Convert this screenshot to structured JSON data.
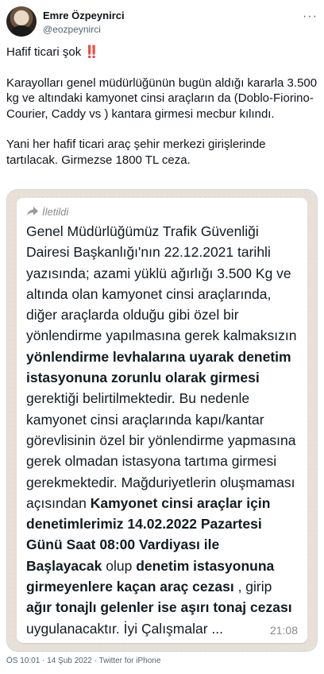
{
  "author": {
    "name": "Emre Özpeynirci",
    "handle": "@eozpeynirci",
    "more": "···"
  },
  "tweet": {
    "line1_text": "Hafif ticari şok",
    "line1_emoji": "‼️",
    "para2": "Karayolları genel müdürlüğünün bugün aldığı kararla 3.500 kg ve altındaki  kamyonet cinsi araçların da (Doblo-Fiorino-Courier, Caddy vs ) kantara girmesi mecbur kılındı.",
    "para3": "Yani her hafif ticari araç şehir merkezi girişlerinde tartılacak. Girmezse 1800 TL ceza."
  },
  "message": {
    "forwarded_label": "İletildi",
    "seg1": "Genel Müdürlüğümüz Trafik Güvenliği Dairesi Başkanlığı'nın 22.12.2021 tarihli yazısında; azami yüklü ağırlığı 3.500 Kg ve altında olan kamyonet cinsi araçlarında, diğer araçlarda olduğu gibi özel bir yönlendirme yapılmasına gerek kalmaksızın ",
    "bold1": "yönlendirme levhalarına uyarak denetim istasyonuna zorunlu olarak girmesi",
    "seg2": " gerektiği belirtilmektedir. Bu nedenle kamyonet cinsi araçlarında kapı/kantar görevlisinin özel bir yönlendirme yapmasına gerek olmadan istasyona tartıma girmesi gerekmektedir. Mağduriyetlerin oluşmaması açısından ",
    "bold2": "Kamyonet cinsi araçlar için denetimlerimiz 14.02.2022 Pazartesi Günü Saat 08:00 Vardiyası ile Başlayacak",
    "seg3": " olup ",
    "bold3": "denetim istasyonuna girmeyenlere kaçan araç cezası",
    "seg4": " , girip ",
    "bold4": "ağır tonajlı gelenler ise aşırı tonaj cezası",
    "seg5": " uygulanacaktır. İyi Çalışmalar ...",
    "time": "21:08"
  },
  "meta": {
    "line": "ÖS 10:01 · 14 Şub 2022 · Twitter for iPhone"
  }
}
